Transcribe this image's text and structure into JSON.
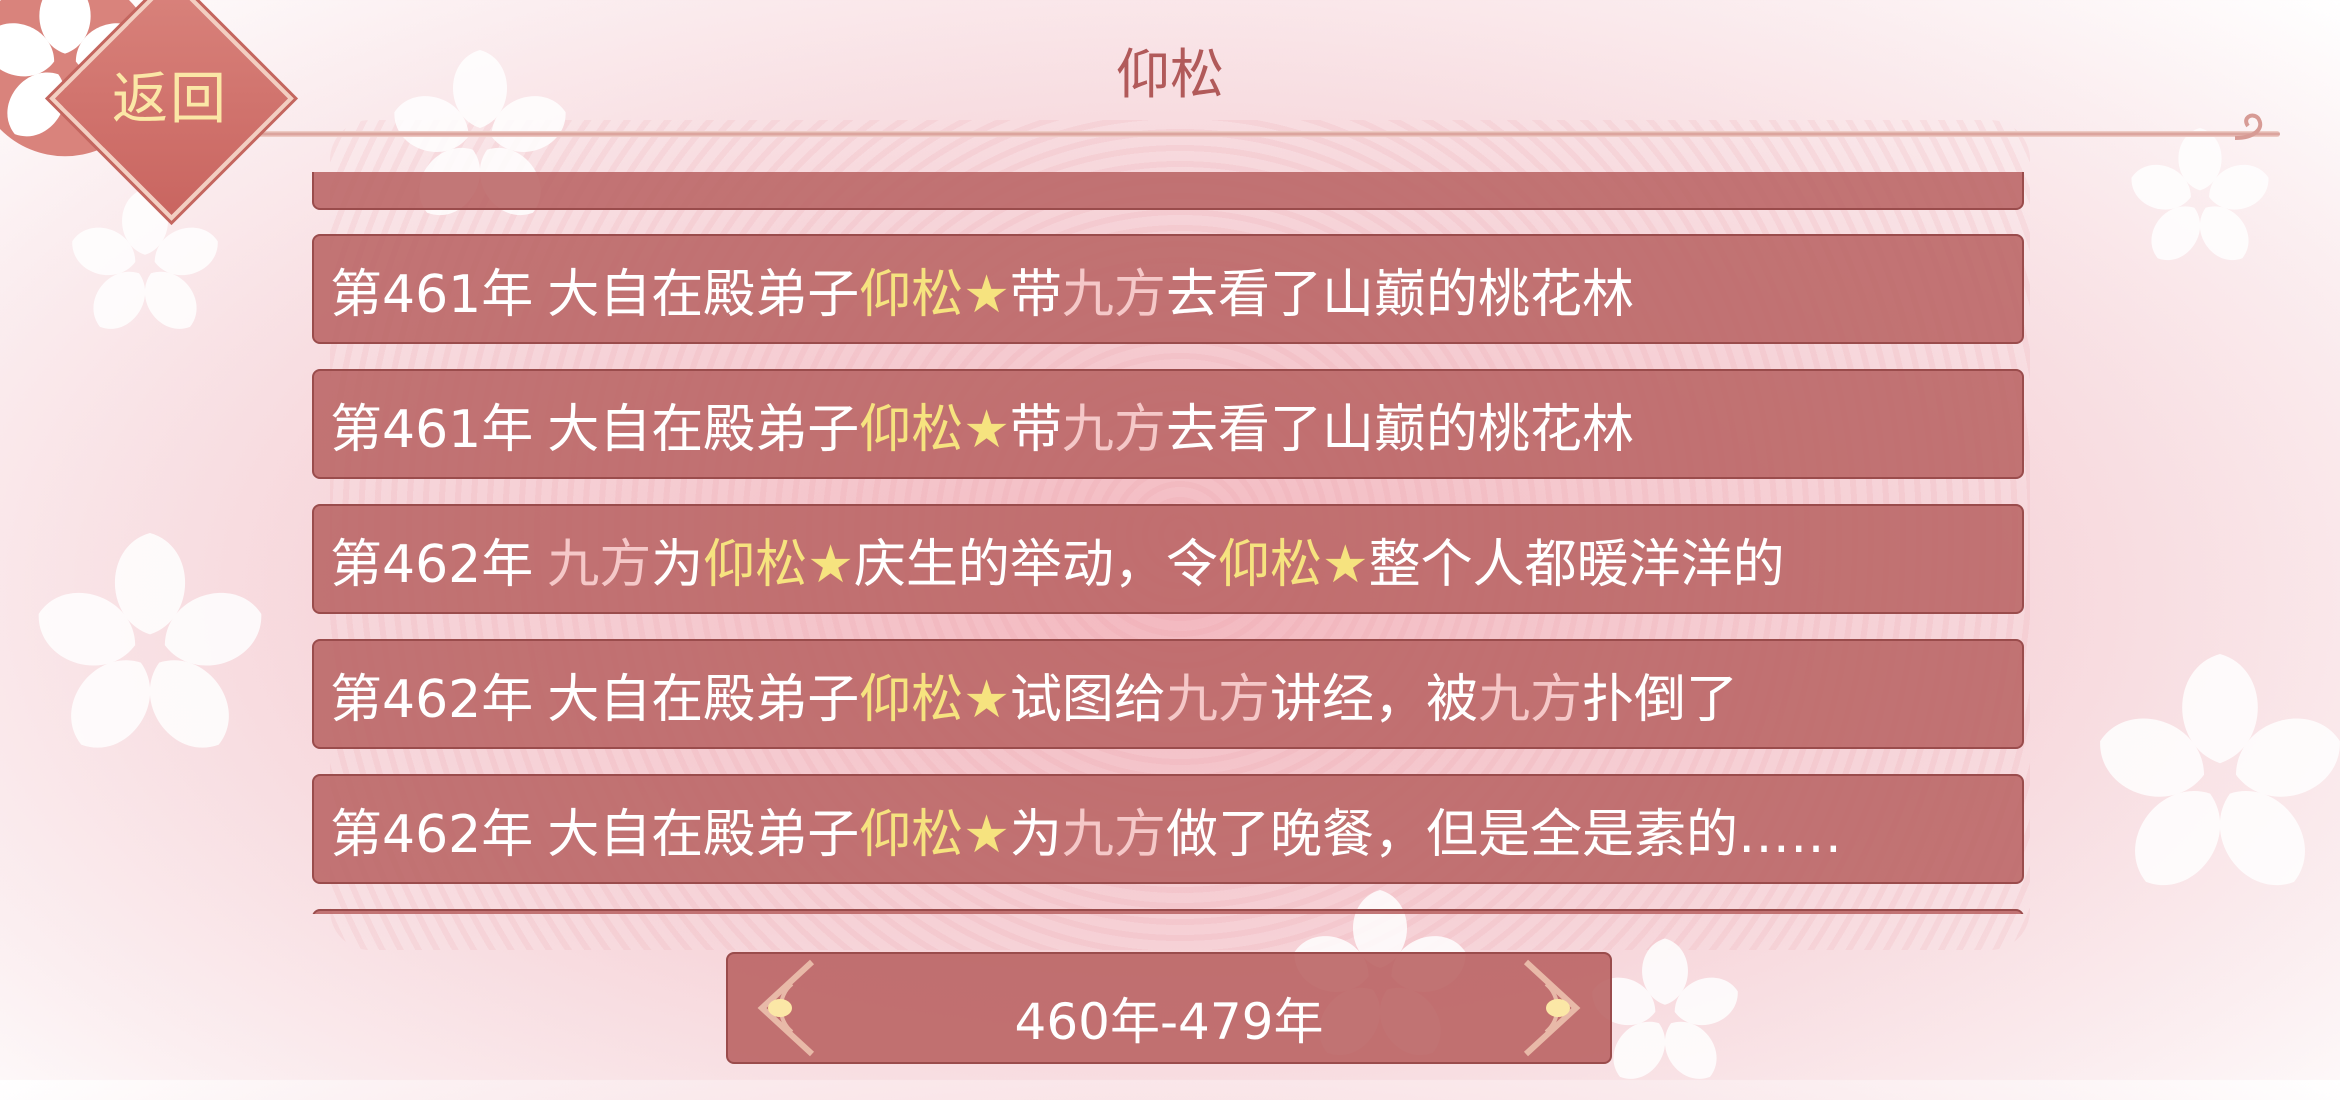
{
  "header": {
    "title": "仰松",
    "back_label": "返回"
  },
  "entries": [
    {
      "year": "第461年",
      "segments": [
        {
          "text": "大自在殿弟子 ",
          "color": "white"
        },
        {
          "text": "仰松★",
          "color": "yellow"
        },
        {
          "text": "带",
          "color": "white"
        },
        {
          "text": "九方",
          "color": "pink"
        },
        {
          "text": "去看了山巅的桃花林",
          "color": "white"
        }
      ]
    },
    {
      "year": "第461年",
      "segments": [
        {
          "text": "大自在殿弟子 ",
          "color": "white"
        },
        {
          "text": "仰松★",
          "color": "yellow"
        },
        {
          "text": "带",
          "color": "white"
        },
        {
          "text": "九方",
          "color": "pink"
        },
        {
          "text": "去看了山巅的桃花林",
          "color": "white"
        }
      ]
    },
    {
      "year": "第462年",
      "segments": [
        {
          "text": "九方",
          "color": "pink"
        },
        {
          "text": "为 ",
          "color": "white"
        },
        {
          "text": "仰松★",
          "color": "yellow"
        },
        {
          "text": "庆生的举动，令",
          "color": "white"
        },
        {
          "text": "仰松★",
          "color": "yellow"
        },
        {
          "text": "整个人都暖洋洋的",
          "color": "white"
        }
      ]
    },
    {
      "year": "第462年",
      "segments": [
        {
          "text": "大自在殿弟子 ",
          "color": "white"
        },
        {
          "text": "仰松★",
          "color": "yellow"
        },
        {
          "text": "试图给",
          "color": "white"
        },
        {
          "text": "九方",
          "color": "pink"
        },
        {
          "text": "讲经，被",
          "color": "white"
        },
        {
          "text": "九方",
          "color": "pink"
        },
        {
          "text": "扑倒了",
          "color": "white"
        }
      ]
    },
    {
      "year": "第462年",
      "segments": [
        {
          "text": "大自在殿弟子 ",
          "color": "white"
        },
        {
          "text": "仰松★",
          "color": "yellow"
        },
        {
          "text": "为",
          "color": "white"
        },
        {
          "text": "九方",
          "color": "pink"
        },
        {
          "text": "做了晚餐，但是全是素的……",
          "color": "white"
        }
      ]
    }
  ],
  "pager": {
    "range_label": "460年-479年"
  },
  "icons": {
    "back": "diamond-badge",
    "prev": "ornate-left-arrow-icon",
    "next": "ornate-right-arrow-icon"
  },
  "colors": {
    "panel": "#ba6464",
    "highlight_name": "#f6e37f",
    "highlight_partner": "#f5c8c8",
    "title": "#b15a5a"
  }
}
